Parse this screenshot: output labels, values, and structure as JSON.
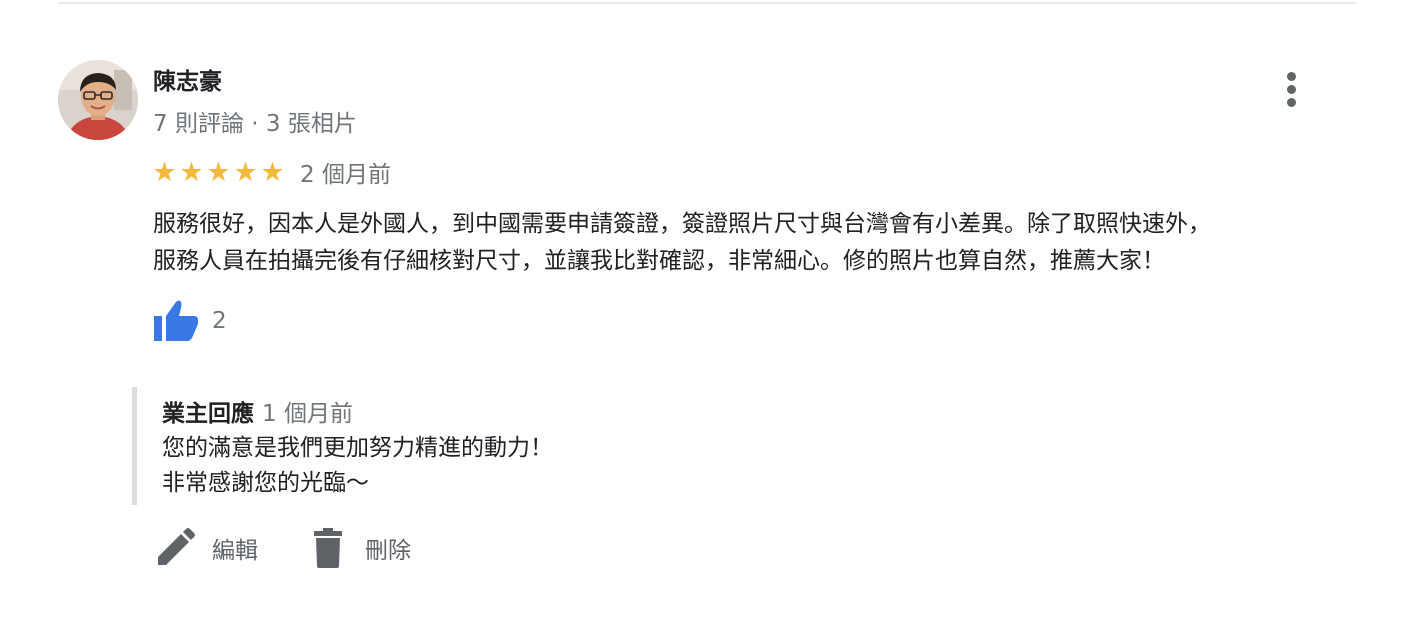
{
  "review": {
    "reviewer_name": "陳志豪",
    "reviewer_meta": "7 則評論 · 3 張相片",
    "rating": 5,
    "date": "2 個月前",
    "text_lines": [
      "服務很好，因本人是外國人，到中國需要申請簽證，簽證照片尺寸與台灣會有小差異。除了取照快速外，",
      "服務人員在拍攝完後有仔細核對尺寸，並讓我比對確認，非常細心。修的照片也算自然，推薦大家！"
    ],
    "like_count": "2"
  },
  "owner_reply": {
    "label": "業主回應",
    "date": "1 個月前",
    "lines": [
      "您的滿意是我們更加努力精進的動力！",
      "非常感謝您的光臨～"
    ]
  },
  "actions": {
    "edit_label": "編輯",
    "delete_label": "刪除"
  },
  "icons": {
    "more": "more-vert-icon",
    "star": "star-icon",
    "like": "thumb-up-icon",
    "edit": "pencil-icon",
    "delete": "trash-icon"
  },
  "colors": {
    "star": "#f4b83f",
    "like": "#3b78e7",
    "secondary_text": "#70757a",
    "icon_gray": "#5f6368"
  }
}
